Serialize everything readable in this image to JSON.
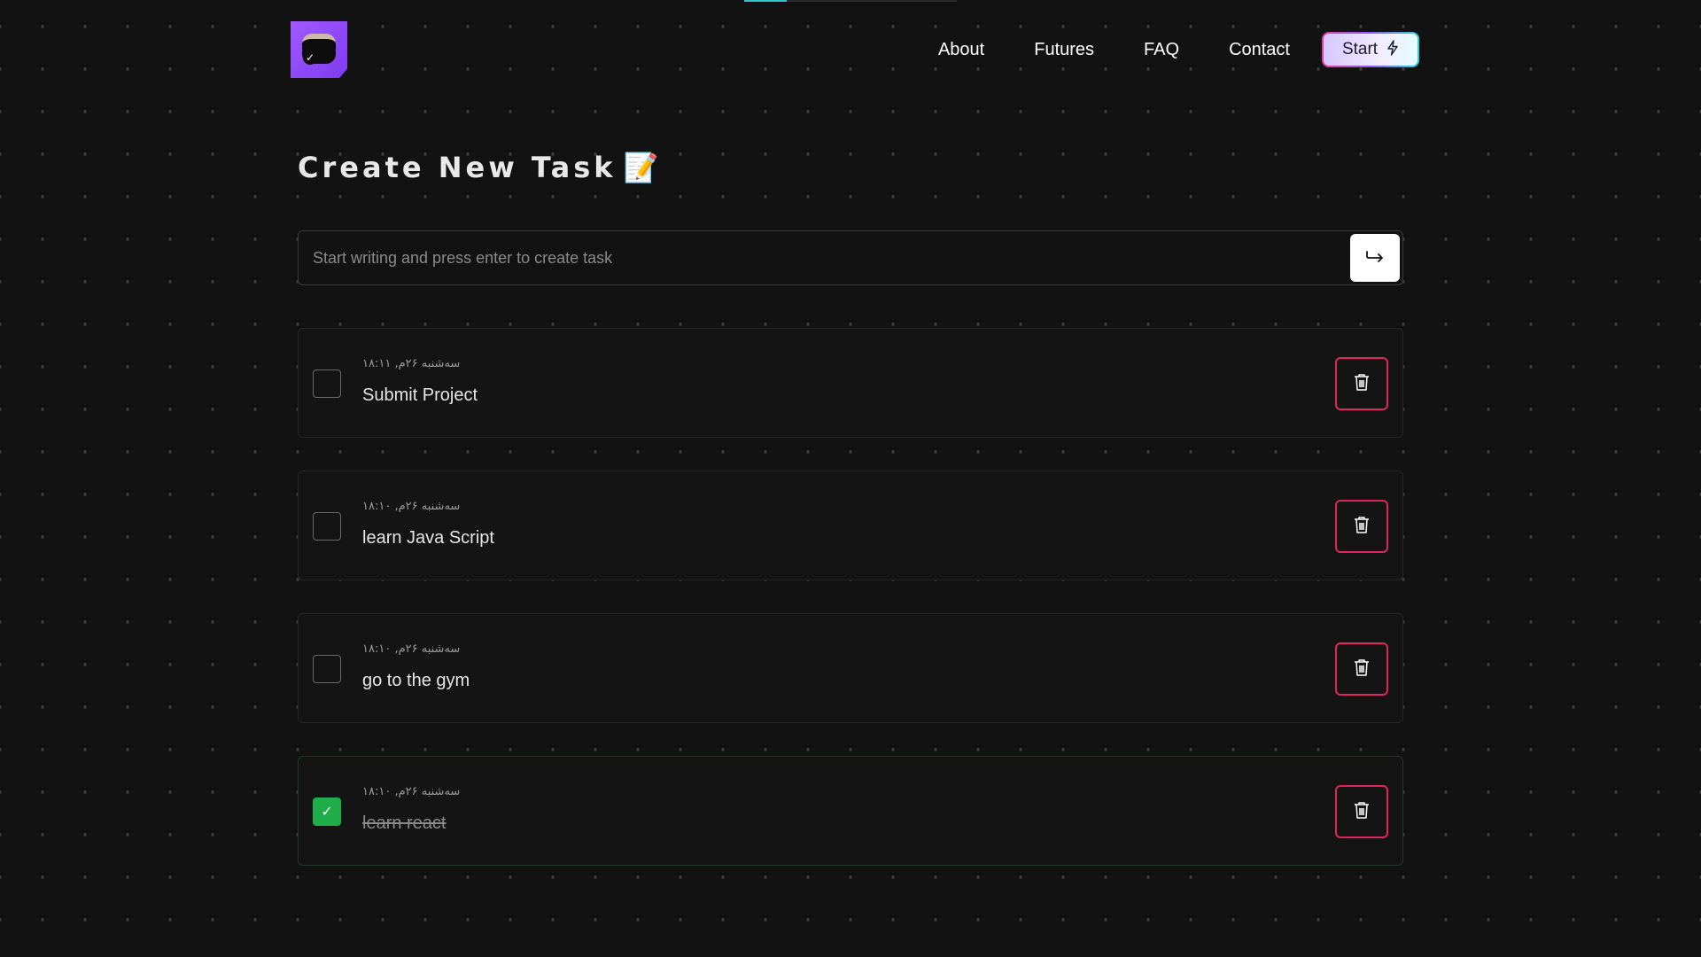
{
  "nav": {
    "logo_icon": "todo-check-icon",
    "links": [
      "About",
      "Futures",
      "FAQ",
      "Contact"
    ],
    "start_label": "Start",
    "start_icon": "lightning-bolt-icon"
  },
  "main": {
    "title": "Create New Task",
    "title_emoji": "📝",
    "input_placeholder": "Start writing and press enter to create task",
    "input_value": "",
    "submit_icon": "enter-arrow-icon"
  },
  "tasks": [
    {
      "time": "سه‌شنبه ۲۶م, ۱۸:۱۱",
      "text": "Submit Project",
      "completed": false
    },
    {
      "time": "سه‌شنبه ۲۶م, ۱۸:۱۰",
      "text": "learn Java Script",
      "completed": false
    },
    {
      "time": "سه‌شنبه ۲۶م, ۱۸:۱۰",
      "text": "go to the gym",
      "completed": false
    },
    {
      "time": "سه‌شنبه ۲۶م, ۱۸:۱۰",
      "text": "learn react",
      "completed": true
    }
  ],
  "colors": {
    "background": "#121212",
    "accent_purple": "#a259ff",
    "delete_red": "#e0245e",
    "check_green": "#1fae4a"
  }
}
